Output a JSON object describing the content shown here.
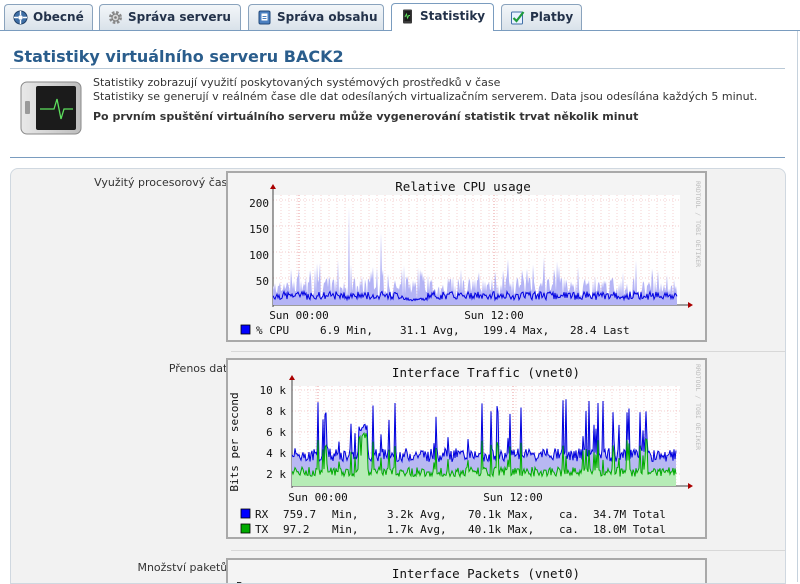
{
  "tabs": [
    {
      "label": "Obecné",
      "icon": "globe-icon"
    },
    {
      "label": "Správa serveru",
      "icon": "gear-icon"
    },
    {
      "label": "Správa obsahu",
      "icon": "document-icon"
    },
    {
      "label": "Statistiky",
      "icon": "monitor-icon",
      "active": true
    },
    {
      "label": "Platby",
      "icon": "checklist-icon"
    }
  ],
  "page": {
    "title": "Statistiky virtuálního serveru BACK2",
    "desc_line1": "Statistiky zobrazují využití poskytovaných systémových prostředků v čase",
    "desc_line2": "Statistiky se generují v reálném čase dle dat odesílaných virtualizačním serverem. Data jsou odesílána každých 5 minut.",
    "desc_bold": "Po prvním spuštění virtuálního serveru může vygenerování statistik trvat několik minut"
  },
  "rows": [
    {
      "label": "Využitý procesorový čas:"
    },
    {
      "label": "Přenos dat:"
    },
    {
      "label": "Množství paketů:"
    }
  ],
  "graphs": {
    "watermark": "RRDTOOL / TOBI OETIKER",
    "cpu": {
      "title": "Relative CPU usage",
      "yticks": [
        "200",
        "150",
        "100",
        "50"
      ],
      "xticks": [
        "Sun 00:00",
        "Sun 12:00"
      ],
      "legend": [
        {
          "name": "% CPU",
          "color": "#0000ff",
          "min": "6.9 Min,",
          "avg": "31.1 Avg,",
          "max": "199.4 Max,",
          "last": "28.4 Last"
        }
      ]
    },
    "traffic": {
      "title": "Interface Traffic (vnet0)",
      "ylabel": "Bits per second",
      "yticks": [
        "10 k",
        "8 k",
        "6 k",
        "4 k",
        "2 k"
      ],
      "xticks": [
        "Sun 00:00",
        "Sun 12:00"
      ],
      "legend": [
        {
          "name": "RX",
          "color": "#0000ff",
          "min": "759.7",
          "min_unit": "Min,",
          "avg": "3.2k Avg,",
          "max": "70.1k Max,",
          "total_prefix": "ca.",
          "total": "34.7M Total"
        },
        {
          "name": "TX",
          "color": "#00aa00",
          "min": "97.2",
          "min_unit": "Min,",
          "avg": "1.7k Avg,",
          "max": "40.1k Max,",
          "total_prefix": "ca.",
          "total": "18.0M Total"
        }
      ]
    },
    "packets": {
      "title": "Interface Packets (vnet0)",
      "ylabel": "P"
    }
  },
  "chart_data": [
    {
      "type": "line",
      "title": "Relative CPU usage",
      "xlabel": "",
      "ylabel": "",
      "x_ticks": [
        "Sun 00:00",
        "Sun 12:00"
      ],
      "ylim": [
        0,
        210
      ],
      "series": [
        {
          "name": "% CPU",
          "min": 6.9,
          "avg": 31.1,
          "max": 199.4,
          "last": 28.4
        }
      ]
    },
    {
      "type": "area",
      "title": "Interface Traffic (vnet0)",
      "ylabel": "Bits per second",
      "x_ticks": [
        "Sun 00:00",
        "Sun 12:00"
      ],
      "ylim": [
        0,
        10500
      ],
      "series": [
        {
          "name": "RX",
          "min": 759.7,
          "avg": 3200,
          "max": 70100,
          "total": "34.7M"
        },
        {
          "name": "TX",
          "min": 97.2,
          "avg": 1700,
          "max": 40100,
          "total": "18.0M"
        }
      ]
    }
  ]
}
